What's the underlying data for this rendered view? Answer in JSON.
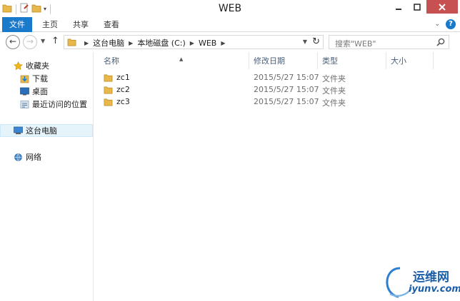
{
  "window": {
    "title": "WEB"
  },
  "ribbon": {
    "tabs": [
      "文件",
      "主页",
      "共享",
      "查看"
    ]
  },
  "nav": {
    "back_glyph": "←",
    "forward_glyph": "→",
    "up_glyph": "↑",
    "breadcrumb": [
      "这台电脑",
      "本地磁盘 (C:)",
      "WEB"
    ],
    "refresh_glyph": "↻"
  },
  "search": {
    "placeholder": "搜索\"WEB\""
  },
  "sidebar": {
    "favorites": "收藏夹",
    "favorites_items": [
      "下载",
      "桌面",
      "最近访问的位置"
    ],
    "this_pc": "这台电脑",
    "network": "网络"
  },
  "filelist": {
    "columns": [
      "名称",
      "修改日期",
      "类型",
      "大小"
    ],
    "rows": [
      {
        "name": "zc1",
        "date": "2015/5/27 15:07",
        "type": "文件夹"
      },
      {
        "name": "zc2",
        "date": "2015/5/27 15:07",
        "type": "文件夹"
      },
      {
        "name": "zc3",
        "date": "2015/5/27 15:07",
        "type": "文件夹"
      }
    ]
  },
  "watermark": {
    "line1": "运维网",
    "line2": "iyunv.com"
  },
  "colors": {
    "accent": "#1979ca",
    "folder": "#e8b84a",
    "close": "#c75050",
    "header_text": "#4c607a"
  }
}
